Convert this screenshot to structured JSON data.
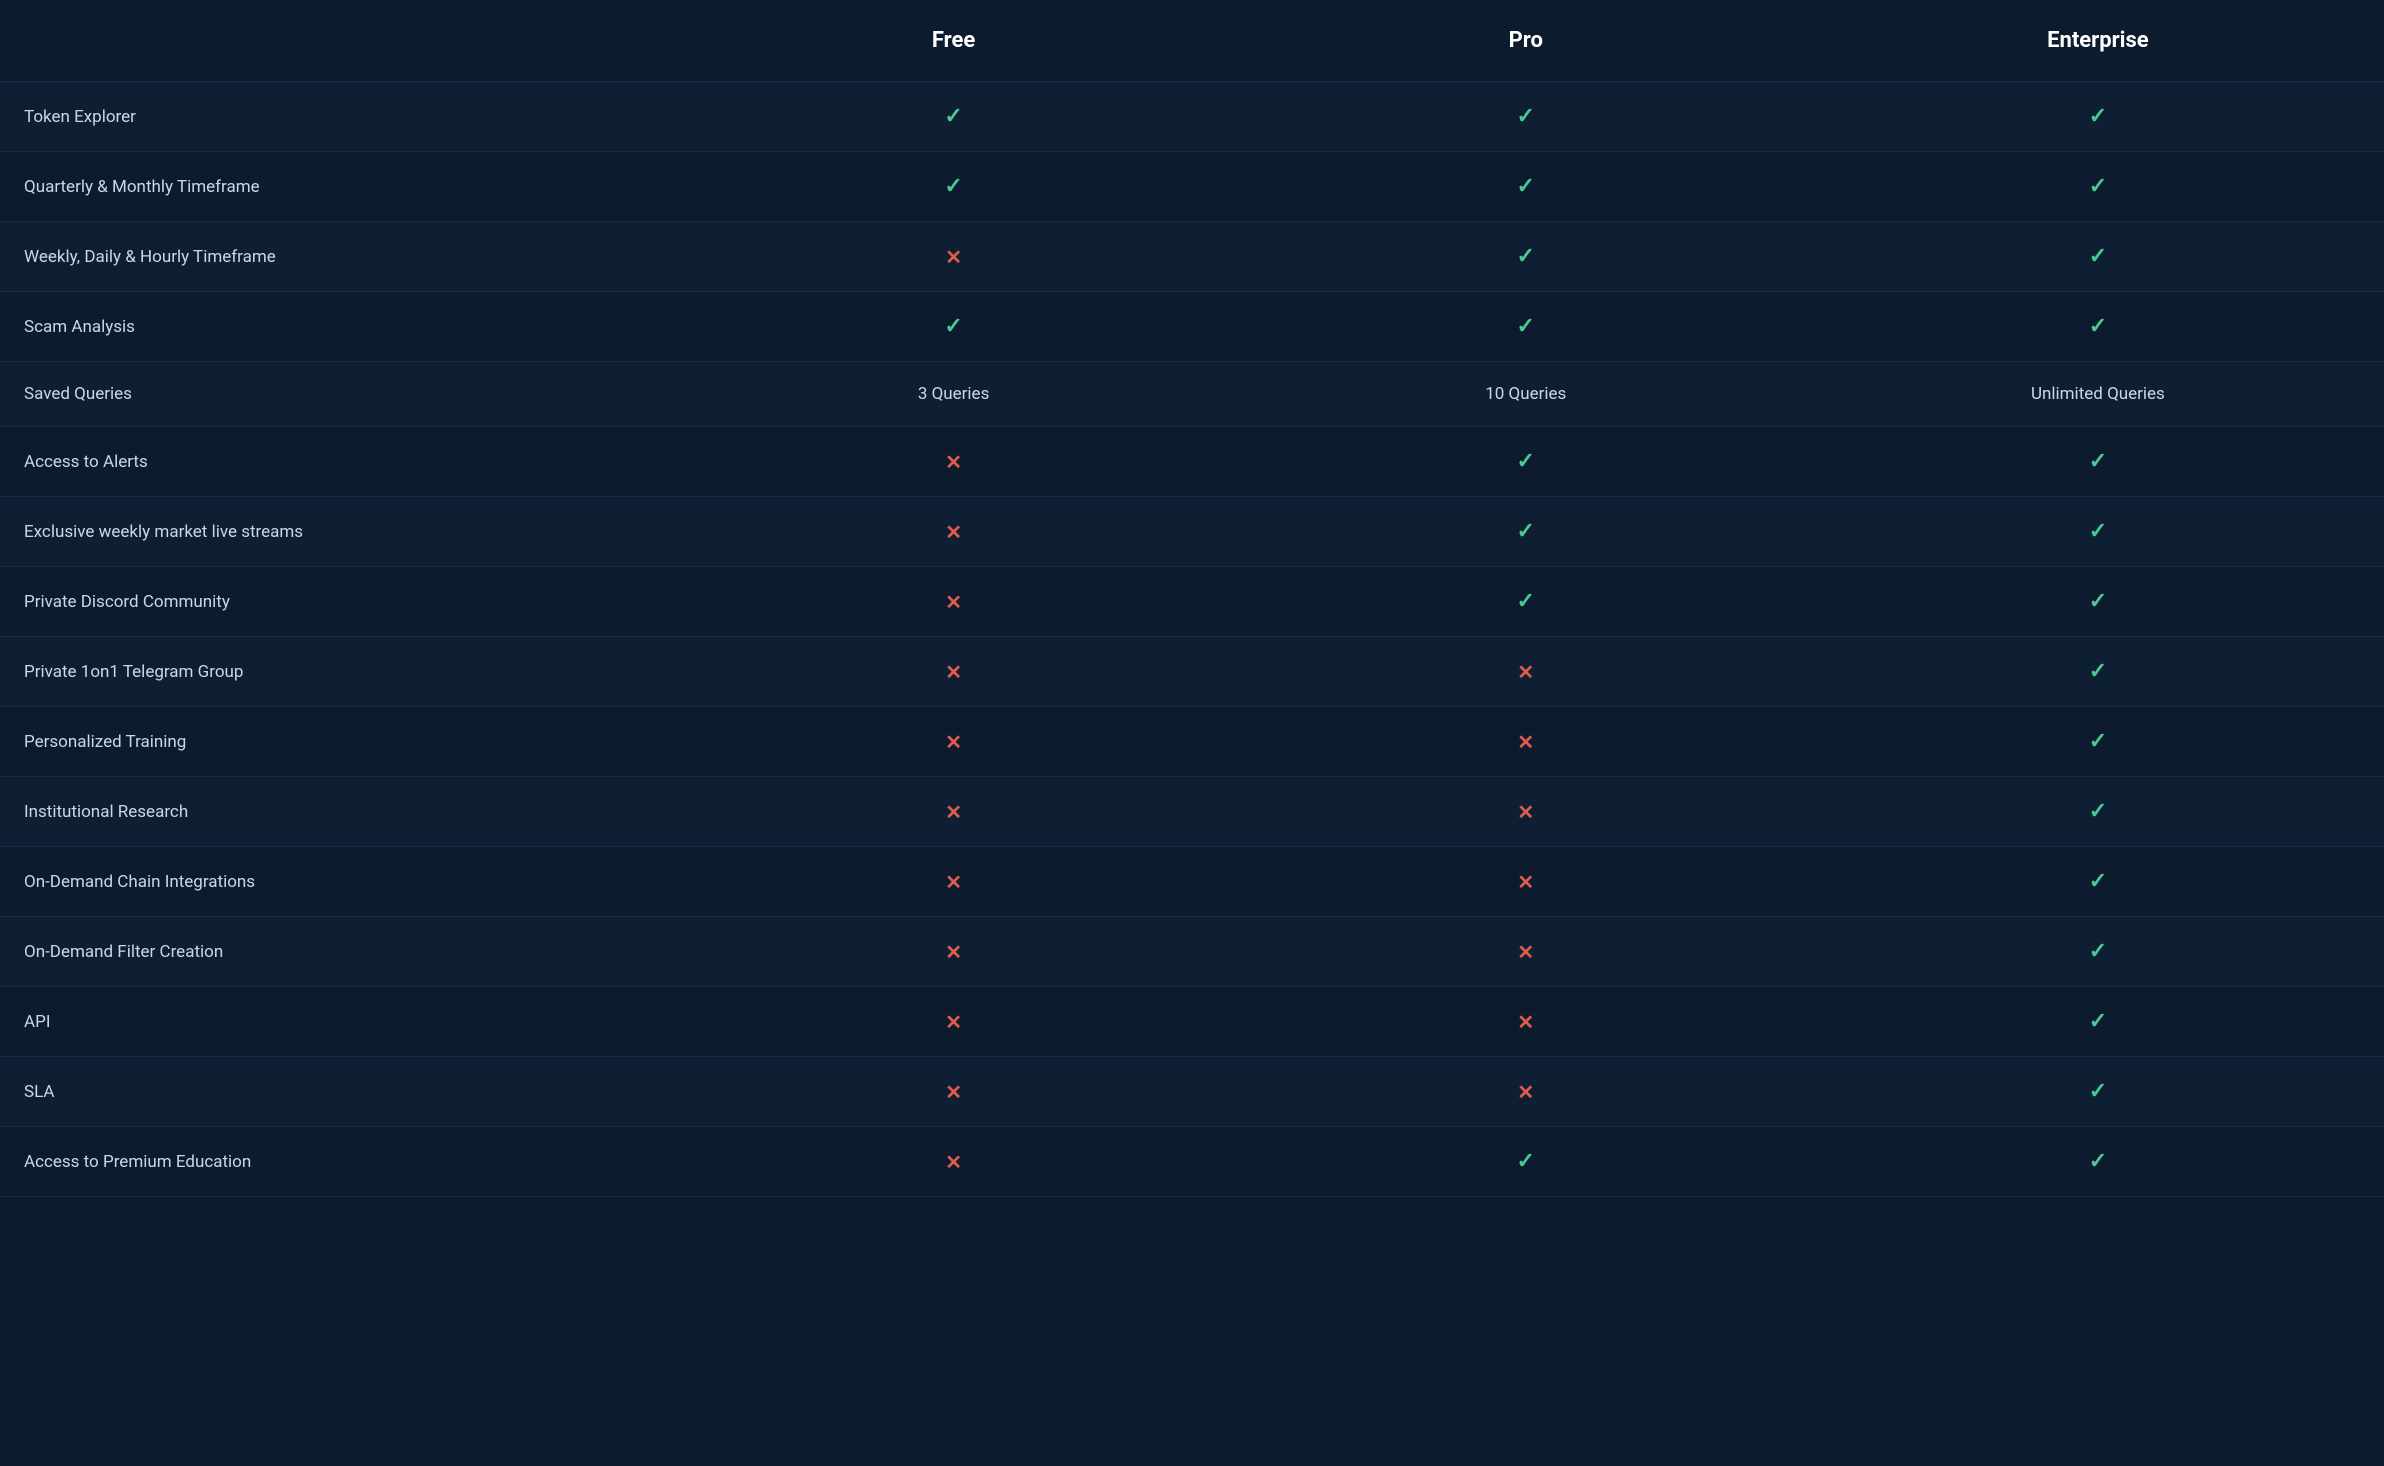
{
  "table": {
    "headers": {
      "feature": "",
      "free": "Free",
      "pro": "Pro",
      "enterprise": "Enterprise"
    },
    "rows": [
      {
        "feature": "Token Explorer",
        "free": "check",
        "pro": "check",
        "enterprise": "check"
      },
      {
        "feature": "Quarterly & Monthly Timeframe",
        "free": "check",
        "pro": "check",
        "enterprise": "check"
      },
      {
        "feature": "Weekly, Daily & Hourly Timeframe",
        "free": "cross",
        "pro": "check",
        "enterprise": "check"
      },
      {
        "feature": "Scam Analysis",
        "free": "check",
        "pro": "check",
        "enterprise": "check"
      },
      {
        "feature": "Saved Queries",
        "free": "3 Queries",
        "pro": "10 Queries",
        "enterprise": "Unlimited Queries"
      },
      {
        "feature": "Access to Alerts",
        "free": "cross",
        "pro": "check",
        "enterprise": "check"
      },
      {
        "feature": "Exclusive weekly market live streams",
        "free": "cross",
        "pro": "check",
        "enterprise": "check"
      },
      {
        "feature": "Private Discord Community",
        "free": "cross",
        "pro": "check",
        "enterprise": "check"
      },
      {
        "feature": "Private 1on1 Telegram Group",
        "free": "cross",
        "pro": "cross",
        "enterprise": "check"
      },
      {
        "feature": "Personalized Training",
        "free": "cross",
        "pro": "cross",
        "enterprise": "check"
      },
      {
        "feature": "Institutional Research",
        "free": "cross",
        "pro": "cross",
        "enterprise": "check"
      },
      {
        "feature": "On-Demand Chain Integrations",
        "free": "cross",
        "pro": "cross",
        "enterprise": "check"
      },
      {
        "feature": "On-Demand Filter Creation",
        "free": "cross",
        "pro": "cross",
        "enterprise": "check"
      },
      {
        "feature": "API",
        "free": "cross",
        "pro": "cross",
        "enterprise": "check"
      },
      {
        "feature": "SLA",
        "free": "cross",
        "pro": "cross",
        "enterprise": "check"
      },
      {
        "feature": "Access to Premium Education",
        "free": "cross",
        "pro": "check",
        "enterprise": "check"
      }
    ]
  }
}
